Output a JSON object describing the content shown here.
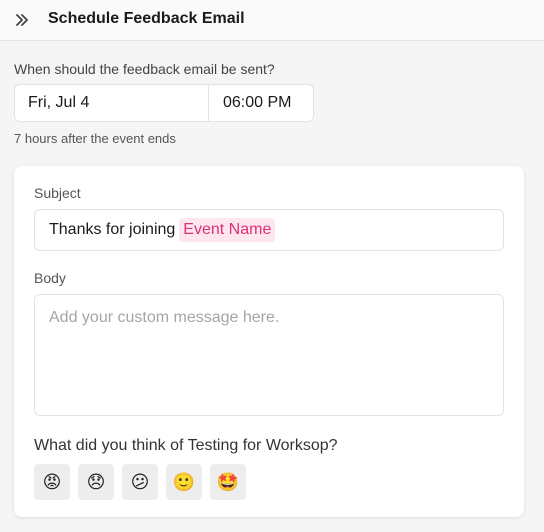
{
  "header": {
    "title": "Schedule Feedback Email",
    "collapse_icon": "double-chevron-right-icon"
  },
  "schedule": {
    "question": "When should the feedback email be sent?",
    "date": "Fri, Jul 4",
    "time": "06:00 PM",
    "helper": "7 hours after the event ends"
  },
  "email": {
    "subject_label": "Subject",
    "subject_text": "Thanks for joining",
    "subject_token": "Event Name",
    "body_label": "Body",
    "body_placeholder": "Add your custom message here."
  },
  "rating": {
    "question": "What did you think of Testing for Worksop?",
    "options": [
      {
        "name": "angry",
        "glyph": "😡"
      },
      {
        "name": "disappointed",
        "glyph": "😞"
      },
      {
        "name": "confused",
        "glyph": "😕"
      },
      {
        "name": "smiling",
        "glyph": "🙂"
      },
      {
        "name": "star-struck",
        "glyph": "🤩"
      }
    ]
  },
  "colors": {
    "token_bg": "#fde6ee",
    "token_text": "#e0307a",
    "page_bg": "#f5f5f5"
  }
}
